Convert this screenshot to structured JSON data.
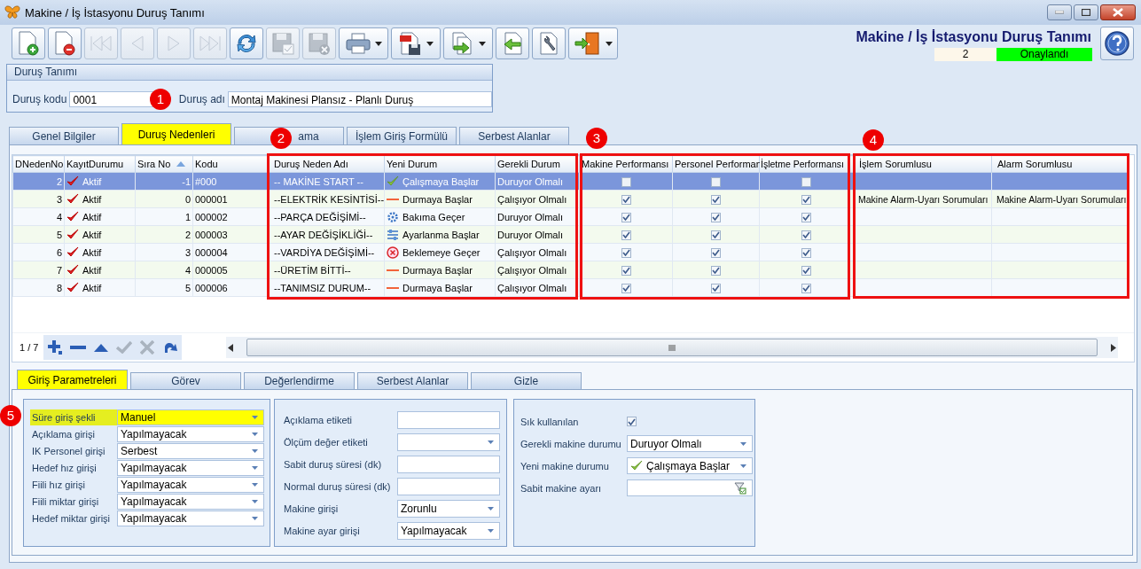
{
  "window": {
    "title": "Makine / İş İstasyonu Duruş Tanımı"
  },
  "toolbar": [
    {
      "kind": "new",
      "disabled": false,
      "dropdown": false
    },
    {
      "kind": "delete",
      "disabled": false,
      "dropdown": false
    },
    {
      "kind": "first",
      "disabled": true,
      "dropdown": false
    },
    {
      "kind": "prev",
      "disabled": true,
      "dropdown": false
    },
    {
      "kind": "next",
      "disabled": true,
      "dropdown": false
    },
    {
      "kind": "last",
      "disabled": true,
      "dropdown": false
    },
    {
      "kind": "refresh",
      "disabled": false,
      "dropdown": false
    },
    {
      "kind": "save",
      "disabled": true,
      "dropdown": false
    },
    {
      "kind": "save-close",
      "disabled": true,
      "dropdown": false
    },
    {
      "kind": "print",
      "disabled": false,
      "dropdown": true
    },
    {
      "kind": "pdf",
      "disabled": false,
      "dropdown": true
    },
    {
      "kind": "export",
      "disabled": false,
      "dropdown": true
    },
    {
      "kind": "import",
      "disabled": false,
      "dropdown": false
    },
    {
      "kind": "tools",
      "disabled": false,
      "dropdown": false
    },
    {
      "kind": "exit",
      "disabled": false,
      "dropdown": true
    }
  ],
  "header": {
    "title": "Makine / İş İstasyonu Duruş Tanımı",
    "record_no": "2",
    "status": "Onaylandı"
  },
  "definition": {
    "title": "Duruş Tanımı",
    "code_label": "Duruş kodu",
    "code": "0001",
    "name_label": "Duruş adı",
    "name": "Montaj Makinesi Plansız - Planlı Duruş"
  },
  "tabs": [
    {
      "label": "Genel Bilgiler",
      "selected": false
    },
    {
      "label": "Duruş Nedenleri",
      "selected": true
    },
    {
      "label": "ama",
      "selected": false
    },
    {
      "label": "İşlem Giriş Formülü",
      "selected": false
    },
    {
      "label": "Serbest Alanlar",
      "selected": false
    }
  ],
  "table": {
    "columns": [
      {
        "label": "DNedenNo",
        "sorted": false
      },
      {
        "label": "KayıtDurumu",
        "sorted": false
      },
      {
        "label": "Sıra No",
        "sorted": true
      },
      {
        "label": "Kodu",
        "sorted": false
      },
      {
        "label": "Duruş Neden Adı",
        "sorted": false
      },
      {
        "label": "Yeni Durum",
        "sorted": false
      },
      {
        "label": "Gerekli Durum",
        "sorted": false
      },
      {
        "label": "Makine Performansı",
        "sorted": false
      },
      {
        "label": "Personel Performan",
        "sorted": false
      },
      {
        "label": "İşletme Performansı",
        "sorted": false
      },
      {
        "label": "İşlem Sorumlusu",
        "sorted": false
      },
      {
        "label": "Alarm Sorumlusu",
        "sorted": false
      }
    ],
    "rows": [
      {
        "selected": true,
        "no": "2",
        "status": "Aktif",
        "order": "-1",
        "code": "#000",
        "name": "-- MAKİNE START --",
        "new_state": {
          "kind": "start",
          "label": "Çalışmaya Başlar"
        },
        "required_state": "Duruyor Olmalı",
        "machine_perf": false,
        "personnel_perf": false,
        "operation_perf": false
      },
      {
        "selected": false,
        "no": "3",
        "status": "Aktif",
        "order": "0",
        "code": "000001",
        "name": "--ELEKTRİK KESİNTİSİ--",
        "new_state": {
          "kind": "stop",
          "label": "Durmaya Başlar"
        },
        "required_state": "Çalışıyor Olmalı",
        "machine_perf": true,
        "personnel_perf": true,
        "operation_perf": true,
        "operation_owner": "Makine Alarm-Uyarı Sorumuları",
        "alarm_owner": "Makine Alarm-Uyarı Sorumuları"
      },
      {
        "selected": false,
        "no": "4",
        "status": "Aktif",
        "order": "1",
        "code": "000002",
        "name": "--PARÇA DEĞİŞİMİ--",
        "new_state": {
          "kind": "maintenance",
          "label": "Bakıma Geçer"
        },
        "required_state": "Duruyor Olmalı",
        "machine_perf": true,
        "personnel_perf": true,
        "operation_perf": true
      },
      {
        "selected": false,
        "no": "5",
        "status": "Aktif",
        "order": "2",
        "code": "000003",
        "name": "--AYAR DEĞİŞİKLİĞİ--",
        "new_state": {
          "kind": "setup",
          "label": "Ayarlanma Başlar"
        },
        "required_state": "Duruyor Olmalı",
        "machine_perf": true,
        "personnel_perf": true,
        "operation_perf": true
      },
      {
        "selected": false,
        "no": "6",
        "status": "Aktif",
        "order": "3",
        "code": "000004",
        "name": "--VARDİYA DEĞİŞİMİ--",
        "new_state": {
          "kind": "wait",
          "label": "Beklemeye Geçer"
        },
        "required_state": "Çalışıyor Olmalı",
        "machine_perf": true,
        "personnel_perf": true,
        "operation_perf": true
      },
      {
        "selected": false,
        "no": "7",
        "status": "Aktif",
        "order": "4",
        "code": "000005",
        "name": "--ÜRETİM BİTTİ--",
        "new_state": {
          "kind": "stop",
          "label": "Durmaya Başlar"
        },
        "required_state": "Çalışıyor Olmalı",
        "machine_perf": true,
        "personnel_perf": true,
        "operation_perf": true
      },
      {
        "selected": false,
        "no": "8",
        "status": "Aktif",
        "order": "5",
        "code": "000006",
        "name": "--TANIMSIZ DURUM--",
        "new_state": {
          "kind": "stop",
          "label": "Durmaya Başlar"
        },
        "required_state": "Çalışıyor Olmalı",
        "machine_perf": true,
        "personnel_perf": true,
        "operation_perf": true
      }
    ]
  },
  "navigator": {
    "position": "1 / 7",
    "buttons": [
      {
        "kind": "add",
        "disabled": false
      },
      {
        "kind": "remove",
        "disabled": false
      },
      {
        "kind": "up",
        "disabled": false
      },
      {
        "kind": "confirm",
        "disabled": true
      },
      {
        "kind": "cancel",
        "disabled": true
      },
      {
        "kind": "redo",
        "disabled": false
      }
    ]
  },
  "lower_tabs": [
    {
      "label": "Giriş Parametreleri",
      "selected": true
    },
    {
      "label": "Görev",
      "selected": false
    },
    {
      "label": "Değerlendirme",
      "selected": false
    },
    {
      "label": "Serbest Alanlar",
      "selected": false
    },
    {
      "label": "Gizle",
      "selected": false
    }
  ],
  "entry_parameters": [
    {
      "label": "Süre giriş şekli",
      "value": "Manuel",
      "highlighted": true
    },
    {
      "label": "Açıklama girişi",
      "value": "Yapılmayacak",
      "highlighted": false
    },
    {
      "label": "IK Personel girişi",
      "value": "Serbest",
      "highlighted": false
    },
    {
      "label": "Hedef hız girişi",
      "value": "Yapılmayacak",
      "highlighted": false
    },
    {
      "label": "Fiili hız girişi",
      "value": "Yapılmayacak",
      "highlighted": false
    },
    {
      "label": "Fiili miktar girişi",
      "value": "Yapılmayacak",
      "highlighted": false
    },
    {
      "label": "Hedef miktar girişi",
      "value": "Yapılmayacak",
      "highlighted": false
    }
  ],
  "labels_panel": [
    {
      "label": "Açıklama etiketi",
      "kind": "text"
    },
    {
      "label": "Ölçüm değer etiketi",
      "kind": "combo"
    },
    {
      "label": "Sabit duruş süresi (dk)",
      "kind": "text"
    },
    {
      "label": "Normal duruş süresi (dk)",
      "kind": "text"
    },
    {
      "label": "Makine girişi",
      "kind": "combo",
      "value": "Zorunlu"
    },
    {
      "label": "Makine ayar girişi",
      "kind": "combo",
      "value": "Yapılmayacak"
    }
  ],
  "machine_panel": [
    {
      "label": "Sık kullanılan",
      "kind": "checkbox",
      "checked": true
    },
    {
      "label": "Gerekli makine durumu",
      "kind": "combo",
      "value": "Duruyor Olmalı"
    },
    {
      "label": "Yeni makine durumu",
      "kind": "status-combo",
      "value": "Çalışmaya Başlar"
    },
    {
      "label": "Sabit makine ayarı",
      "kind": "lookup"
    }
  ],
  "markers": [
    {
      "label": "1"
    },
    {
      "label": "2"
    },
    {
      "label": "3"
    },
    {
      "label": "4"
    },
    {
      "label": "5"
    }
  ]
}
